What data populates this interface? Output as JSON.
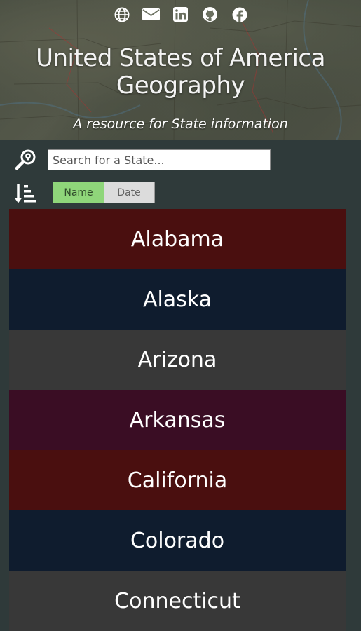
{
  "header": {
    "title": "United States of America Geography",
    "subtitle": "A resource for State information",
    "social_icons": [
      "globe-icon",
      "envelope-icon",
      "linkedin-icon",
      "github-icon",
      "facebook-icon"
    ]
  },
  "search": {
    "placeholder": "Search for a State..."
  },
  "sort": {
    "options": [
      "Name",
      "Date"
    ],
    "selected": "Name"
  },
  "states": [
    {
      "name": "Alabama",
      "color": "#4a0f0f"
    },
    {
      "name": "Alaska",
      "color": "#0f1c2e"
    },
    {
      "name": "Arizona",
      "color": "#383838"
    },
    {
      "name": "Arkansas",
      "color": "#3a0d24"
    },
    {
      "name": "California",
      "color": "#4a0f0f"
    },
    {
      "name": "Colorado",
      "color": "#0f1c2e"
    },
    {
      "name": "Connecticut",
      "color": "#383838"
    }
  ],
  "colors": {
    "background": "#2f3a3a",
    "toggle_active": "#8fd67a",
    "toggle_inactive": "#dcdcdc"
  }
}
